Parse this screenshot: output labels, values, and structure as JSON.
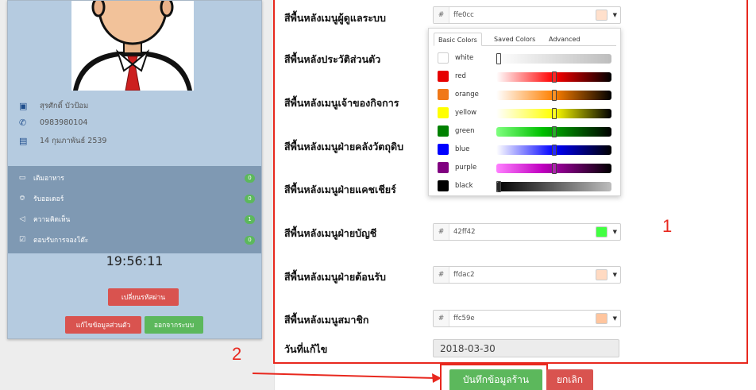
{
  "profile": {
    "name": "สุรศักดิ์ บัวป้อม",
    "phone": "0983980104",
    "birthday": "14 กุมภาพันธ์ 2539"
  },
  "menu": {
    "items": [
      {
        "label": "เติมอาหาร",
        "icon": "battery-icon",
        "count": "0"
      },
      {
        "label": "รับออเดอร์",
        "icon": "bell-icon",
        "count": "0"
      },
      {
        "label": "ความคิดเห็น",
        "icon": "megaphone-icon",
        "count": "1"
      },
      {
        "label": "ตอบรับการจองโต๊ะ",
        "icon": "check-square-icon",
        "count": "0"
      }
    ]
  },
  "clock": "19:56:11",
  "buttons": {
    "change_password": "เปลี่ยนรหัสผ่าน",
    "edit_profile": "แก้ไขข้อมูลส่วนตัว",
    "logout": "ออกจากระบบ",
    "save": "บันทึกข้อมูลร้าน",
    "cancel": "ยกเลิก"
  },
  "form": {
    "fields": [
      {
        "label": "สีพื้นหลังเมนูผู้ดูแลระบบ",
        "hex": "ffe0cc",
        "swatch": "#ffe0cc"
      },
      {
        "label": "สีพื้นหลังประวัติส่วนตัว"
      },
      {
        "label": "สีพื้นหลังเมนูเจ้าของกิจการ"
      },
      {
        "label": "สีพื้นหลังเมนูฝ่ายคลังวัตถุดิบ"
      },
      {
        "label": "สีพื้นหลังเมนูฝ่ายแคชเชียร์"
      },
      {
        "label": "สีพื้นหลังเมนูฝ่ายบัญชี",
        "hex": "42ff42",
        "swatch": "#42ff42"
      },
      {
        "label": "สีพื้นหลังเมนูฝ่ายต้อนรับ",
        "hex": "ffdac2",
        "swatch": "#ffdac2"
      },
      {
        "label": "สีพื้นหลังเมนูสมาชิก",
        "hex": "ffc59e",
        "swatch": "#ffc59e"
      }
    ],
    "date_label": "วันที่แก้ไข",
    "date_value": "2018-03-30",
    "hash": "#"
  },
  "picker": {
    "tabs": [
      "Basic Colors",
      "Saved Colors",
      "Advanced"
    ],
    "rows": [
      {
        "name": "white",
        "color": "#ffffff",
        "gradient": "linear-gradient(to right,#ffffff,#bdbdbd)",
        "level": 0.02
      },
      {
        "name": "red",
        "color": "#e60000",
        "gradient": "linear-gradient(to right,#ffffff,#ff0000 50%,#000000)",
        "level": 0.5
      },
      {
        "name": "orange",
        "color": "#f07818",
        "gradient": "linear-gradient(to right,#ffffff,#ff8000 50%,#000000)",
        "level": 0.5
      },
      {
        "name": "yellow",
        "color": "#ffff00",
        "gradient": "linear-gradient(to right,#ffffff,#ffff00 50%,#000000)",
        "level": 0.5
      },
      {
        "name": "green",
        "color": "#008000",
        "gradient": "linear-gradient(to right,#7fff7f,#00c000 40%,#000000)",
        "level": 0.5
      },
      {
        "name": "blue",
        "color": "#0000ff",
        "gradient": "linear-gradient(to right,#ffffff,#0000ff 50%,#000000)",
        "level": 0.5
      },
      {
        "name": "purple",
        "color": "#800080",
        "gradient": "linear-gradient(to right,#ff80ff,#c000c0 40%,#000000)",
        "level": 0.5
      },
      {
        "name": "black",
        "color": "#000000",
        "gradient": "linear-gradient(to right,#000000,#bdbdbd)",
        "level": 0.02
      }
    ]
  },
  "annotations": {
    "step1": "1",
    "step2": "2"
  }
}
